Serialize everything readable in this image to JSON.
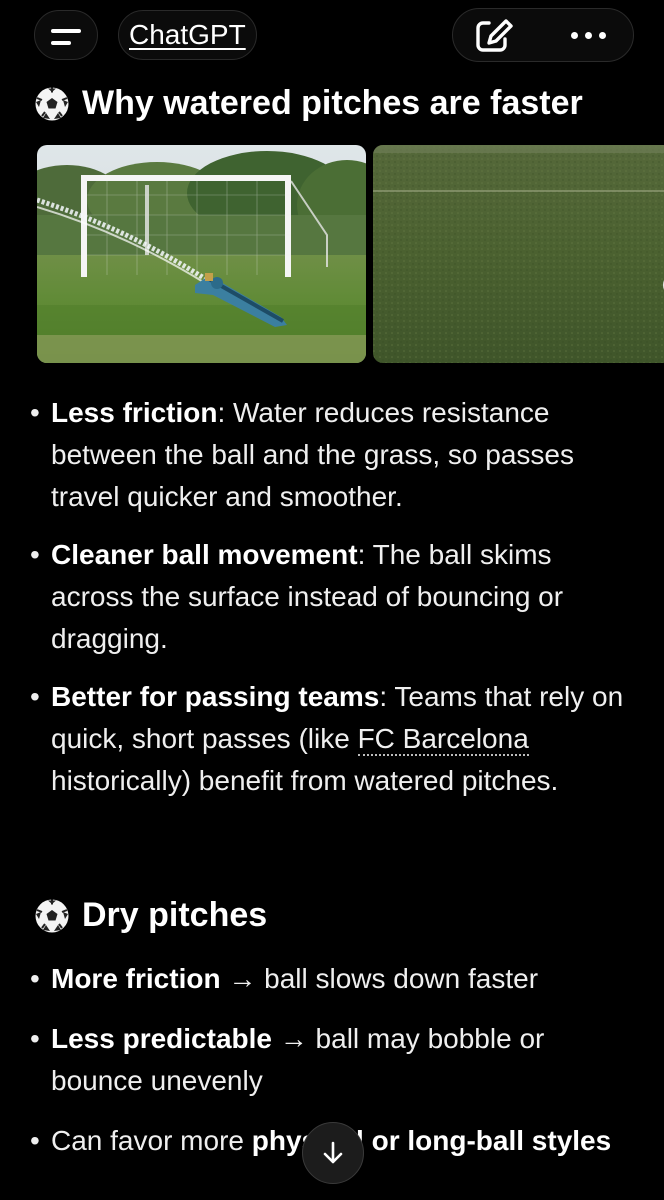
{
  "topbar": {
    "title": "ChatGPT",
    "menu_icon": "hamburger-menu-icon",
    "new_chat_icon": "edit-compose-icon",
    "more_icon": "more-dots-icon"
  },
  "section1": {
    "icon": "soccer-ball-icon",
    "heading": "Why watered pitches are faster",
    "images": [
      "sprinkler-watering-pitch",
      "wet-grass-field"
    ],
    "bullets": [
      {
        "bold": "Less friction",
        "text": ": Water reduces resistance between the ball and the grass, so passes travel quicker and smoother."
      },
      {
        "bold": "Cleaner ball movement",
        "text": ": The ball skims across the surface instead of bouncing or dragging."
      },
      {
        "bold": "Better for passing teams",
        "text_before": ": Teams that rely on quick, short passes (like ",
        "link": "FC Barcelona",
        "text_after": " historically) benefit from watered pitches."
      }
    ]
  },
  "section2": {
    "icon": "soccer-ball-icon",
    "heading": "Dry pitches",
    "bullets": [
      {
        "bold": "More friction",
        "text": " → ball slows down faster"
      },
      {
        "bold": "Less predictable",
        "text": " → ball may bobble or bounce unevenly"
      },
      {
        "text_before": "Can favor more ",
        "bold": "physical or long-ball styles"
      }
    ]
  },
  "scroll_button_icon": "arrow-down-icon",
  "colors": {
    "background": "#000000",
    "text": "#efefef",
    "pill_background": "#0b0b0b"
  }
}
